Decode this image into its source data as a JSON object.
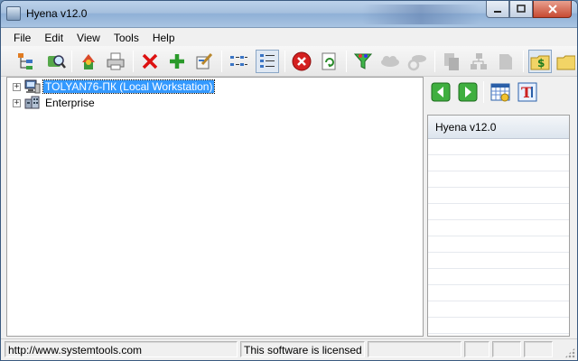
{
  "window": {
    "title": "Hyena v12.0"
  },
  "menu": [
    "File",
    "Edit",
    "View",
    "Tools",
    "Help"
  ],
  "toolbar": {
    "buttons": [
      "tree-view-icon",
      "find-icon",
      "refresh-objects-icon",
      "print-icon",
      "delete-icon",
      "add-icon",
      "properties-icon",
      "large-icons-view-icon",
      "details-view-icon",
      "stop-icon",
      "reload-icon",
      "filter-icon",
      "cloud-icon",
      "cloud-sync-icon",
      "copy-icon",
      "hierarchy-icon",
      "document-icon",
      "money-folder-icon",
      "folder-icon"
    ]
  },
  "tree": {
    "nodes": [
      {
        "label": "TOLYAN76-ПК (Local Workstation)",
        "selected": true,
        "icon": "workstation-icon"
      },
      {
        "label": "Enterprise",
        "selected": false,
        "icon": "enterprise-icon"
      }
    ]
  },
  "right_pane": {
    "header": "Hyena v12.0",
    "nav": [
      "back-arrow-icon",
      "forward-arrow-icon",
      "calendar-icon",
      "text-icon"
    ]
  },
  "status": {
    "url": "http://www.systemtools.com",
    "license": "This software is licensed t"
  },
  "colors": {
    "selection": "#3399ff",
    "titlebar": "#a6c0de"
  }
}
